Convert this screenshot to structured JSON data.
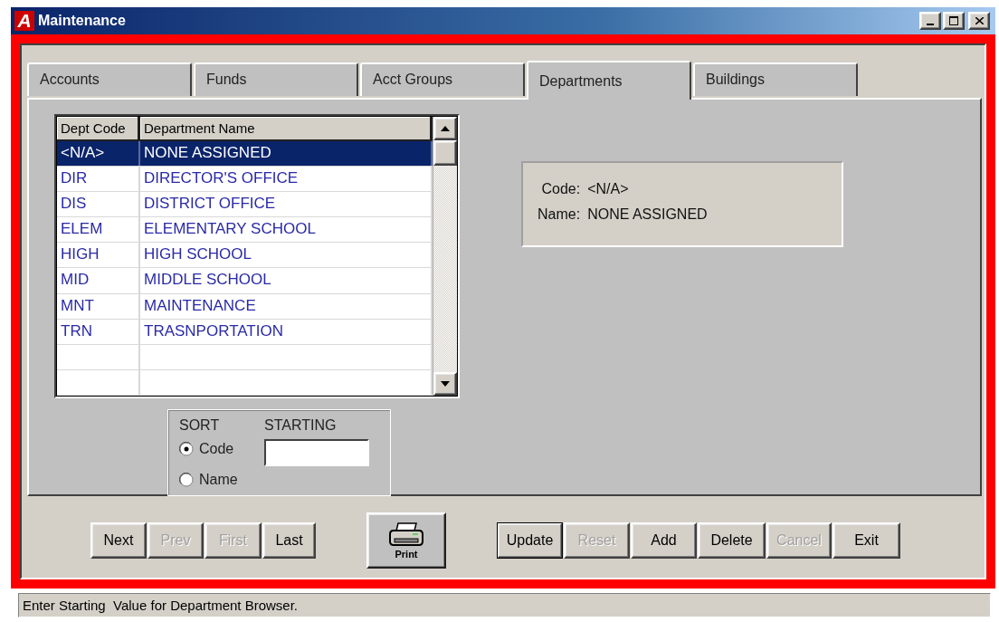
{
  "window": {
    "logo": "A",
    "title": "Maintenance"
  },
  "tabs": [
    {
      "label": "Accounts",
      "selected": false
    },
    {
      "label": "Funds",
      "selected": false
    },
    {
      "label": "Acct Groups",
      "selected": false
    },
    {
      "label": "Departments",
      "selected": true
    },
    {
      "label": "Buildings",
      "selected": false
    }
  ],
  "department_list": {
    "columns": [
      "Dept Code",
      "Department Name"
    ],
    "rows": [
      {
        "code": "<N/A>",
        "name": "NONE ASSIGNED",
        "selected": true
      },
      {
        "code": "DIR",
        "name": "DIRECTOR'S OFFICE",
        "selected": false
      },
      {
        "code": "DIS",
        "name": "DISTRICT OFFICE",
        "selected": false
      },
      {
        "code": "ELEM",
        "name": "ELEMENTARY SCHOOL",
        "selected": false
      },
      {
        "code": "HIGH",
        "name": "HIGH SCHOOL",
        "selected": false
      },
      {
        "code": "MID",
        "name": "MIDDLE SCHOOL",
        "selected": false
      },
      {
        "code": "MNT",
        "name": "MAINTENANCE",
        "selected": false
      },
      {
        "code": "TRN",
        "name": "TRASNPORTATION",
        "selected": false
      }
    ]
  },
  "sort": {
    "label": "SORT",
    "options": [
      {
        "label": "Code",
        "selected": true
      },
      {
        "label": "Name",
        "selected": false
      }
    ],
    "starting_label": "STARTING"
  },
  "details": {
    "code_label": "Code:",
    "code_value": "<N/A>",
    "name_label": "Name:",
    "name_value": "NONE ASSIGNED"
  },
  "nav_buttons": [
    {
      "label": "Next",
      "disabled": false
    },
    {
      "label": "Prev",
      "disabled": true
    },
    {
      "label": "First",
      "disabled": true
    },
    {
      "label": "Last",
      "disabled": false
    }
  ],
  "print_button": {
    "label": "Print"
  },
  "action_buttons": [
    {
      "label": "Update",
      "disabled": false,
      "focused": true
    },
    {
      "label": "Reset",
      "disabled": true,
      "focused": false
    },
    {
      "label": "Add",
      "disabled": false,
      "focused": false
    },
    {
      "label": "Delete",
      "disabled": false,
      "focused": false
    },
    {
      "label": "Cancel",
      "disabled": true,
      "focused": false
    },
    {
      "label": "Exit",
      "disabled": false,
      "focused": false
    }
  ],
  "status_bar": "Enter Starting  Value for Department Browser."
}
